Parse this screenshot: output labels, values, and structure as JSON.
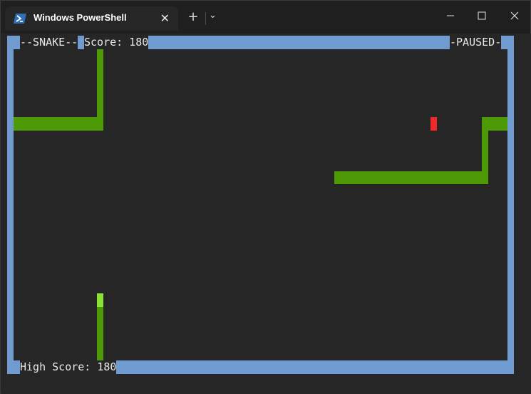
{
  "window": {
    "tab_title": "Windows PowerShell",
    "tab_icon": "powershell-icon",
    "new_tab_symbol": "+",
    "dropdown_symbol": "⌄",
    "close_tab_symbol": "✕"
  },
  "game": {
    "title_label": "--SNAKE--",
    "score_label": "Score: 180",
    "status_label": "-PAUSED-",
    "high_score_label": "High Score: 180",
    "colors": {
      "border": "#6f9bd1",
      "snake_body": "#4e9a06",
      "snake_head": "#8ae234",
      "food": "#ef2929",
      "background": "#262626"
    }
  }
}
